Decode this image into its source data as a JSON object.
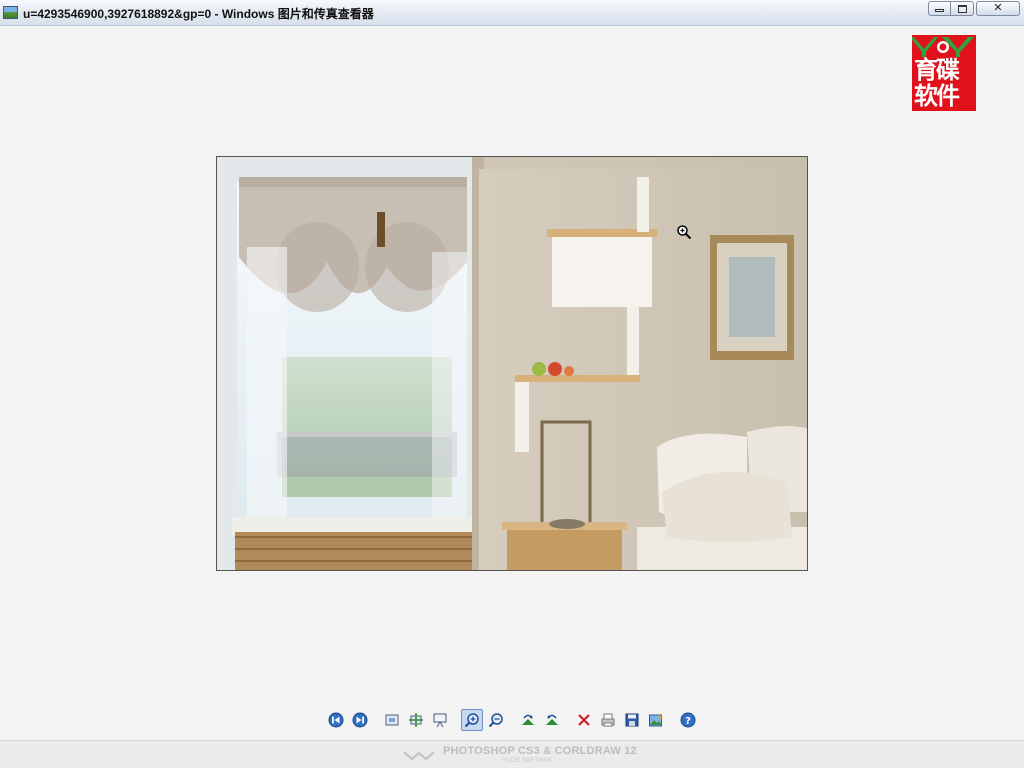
{
  "window": {
    "title": "u=4293546900,3927618892&gp=0 - Windows 图片和传真查看器",
    "buttons": {
      "minimize": "minimize",
      "maximize": "maximize",
      "close": "✕"
    }
  },
  "watermark": {
    "line1": "育碟",
    "line2": "软件",
    "brand": "YY"
  },
  "image": {
    "description_icon": "bedroom-photo"
  },
  "toolbar": {
    "items": [
      {
        "name": "previous-image-button",
        "icon": "previous-icon"
      },
      {
        "name": "next-image-button",
        "icon": "next-icon"
      },
      {
        "name": "best-fit-button",
        "icon": "best-fit-icon"
      },
      {
        "name": "actual-size-button",
        "icon": "actual-size-icon"
      },
      {
        "name": "slideshow-button",
        "icon": "slideshow-icon"
      },
      {
        "name": "zoom-in-button",
        "icon": "zoom-in-icon",
        "active": true
      },
      {
        "name": "zoom-out-button",
        "icon": "zoom-out-icon"
      },
      {
        "name": "rotate-clockwise-button",
        "icon": "rotate-clockwise-icon"
      },
      {
        "name": "rotate-counterclockwise-button",
        "icon": "rotate-counterclockwise-icon"
      },
      {
        "name": "delete-button",
        "icon": "delete-icon"
      },
      {
        "name": "print-button",
        "icon": "print-icon"
      },
      {
        "name": "save-button",
        "icon": "save-icon"
      },
      {
        "name": "open-editor-button",
        "icon": "edit-icon"
      },
      {
        "name": "help-button",
        "icon": "help-icon"
      }
    ]
  },
  "footer": {
    "brand": "PHOTOSHOP CS3 & CORLDRAW 12",
    "sub": "YUDIE SOFTWAR"
  },
  "colors": {
    "accent": "#e0111b",
    "logo_green": "#2fa43a",
    "titlebar": "#dfe6f0"
  }
}
